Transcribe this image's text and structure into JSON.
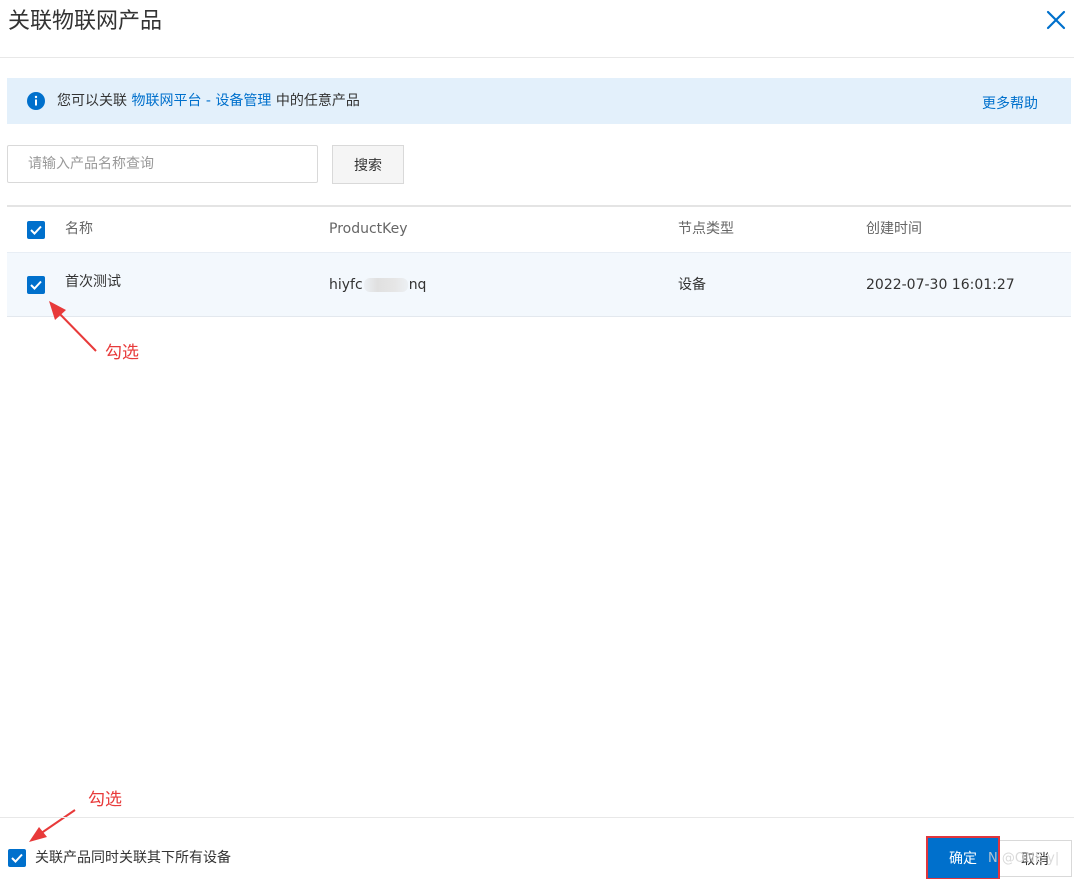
{
  "dialog": {
    "title": "关联物联网产品",
    "close_icon": "close-icon"
  },
  "notice": {
    "icon": "info-icon",
    "text_before": "您可以关联 ",
    "link_text": "物联网平台 - 设备管理",
    "text_after": " 中的任意产品",
    "help_link": "更多帮助"
  },
  "search": {
    "placeholder": "请输入产品名称查询",
    "value": "",
    "button_label": "搜索"
  },
  "table": {
    "header_checked": true,
    "columns": [
      "名称",
      "ProductKey",
      "节点类型",
      "创建时间"
    ],
    "rows": [
      {
        "checked": true,
        "name": "首次测试",
        "product_key_prefix": "hiyfc",
        "product_key_suffix": "nq",
        "node_type": "设备",
        "created": "2022-07-30 16:01:27"
      }
    ]
  },
  "annotations": {
    "row_check": "勾选",
    "footer_check": "勾选"
  },
  "footer": {
    "associate_all_checked": true,
    "associate_all_label": "关联产品同时关联其下所有设备",
    "confirm_label": "确定",
    "cancel_label": "取消",
    "watermark": "N @ONE·y|"
  },
  "colors": {
    "accent": "#0070cc",
    "notice_bg": "#e3f0fb",
    "annotation": "#e83a3a",
    "highlight_border": "#e0353d"
  }
}
